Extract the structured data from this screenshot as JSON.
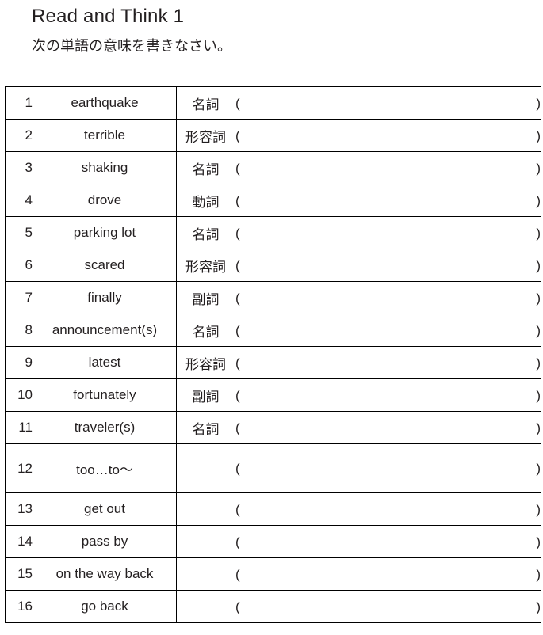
{
  "header": {
    "title": "Read and Think 1",
    "instruction": "次の単語の意味を書きなさい。"
  },
  "table": {
    "paren_open": "(",
    "paren_close": ")",
    "rows": [
      {
        "num": "1",
        "word": "earthquake",
        "pos": "名詞",
        "tall": false
      },
      {
        "num": "2",
        "word": "terrible",
        "pos": "形容詞",
        "tall": false
      },
      {
        "num": "3",
        "word": "shaking",
        "pos": "名詞",
        "tall": false
      },
      {
        "num": "4",
        "word": "drove",
        "pos": "動詞",
        "tall": false
      },
      {
        "num": "5",
        "word": "parking lot",
        "pos": "名詞",
        "tall": false
      },
      {
        "num": "6",
        "word": "scared",
        "pos": "形容詞",
        "tall": false
      },
      {
        "num": "7",
        "word": "finally",
        "pos": "副詞",
        "tall": false
      },
      {
        "num": "8",
        "word": "announcement(s)",
        "pos": "名詞",
        "tall": false
      },
      {
        "num": "9",
        "word": "latest",
        "pos": "形容詞",
        "tall": false
      },
      {
        "num": "10",
        "word": "fortunately",
        "pos": "副詞",
        "tall": false
      },
      {
        "num": "11",
        "word": "traveler(s)",
        "pos": "名詞",
        "tall": false
      },
      {
        "num": "12",
        "word": "too…to〜",
        "pos": "",
        "tall": true
      },
      {
        "num": "13",
        "word": "get out",
        "pos": "",
        "tall": false
      },
      {
        "num": "14",
        "word": "pass by",
        "pos": "",
        "tall": false
      },
      {
        "num": "15",
        "word": "on the way back",
        "pos": "",
        "tall": false
      },
      {
        "num": "16",
        "word": "go back",
        "pos": "",
        "tall": false
      }
    ]
  },
  "colors": {
    "text": "#231f20",
    "border": "#000000",
    "background": "#ffffff"
  }
}
